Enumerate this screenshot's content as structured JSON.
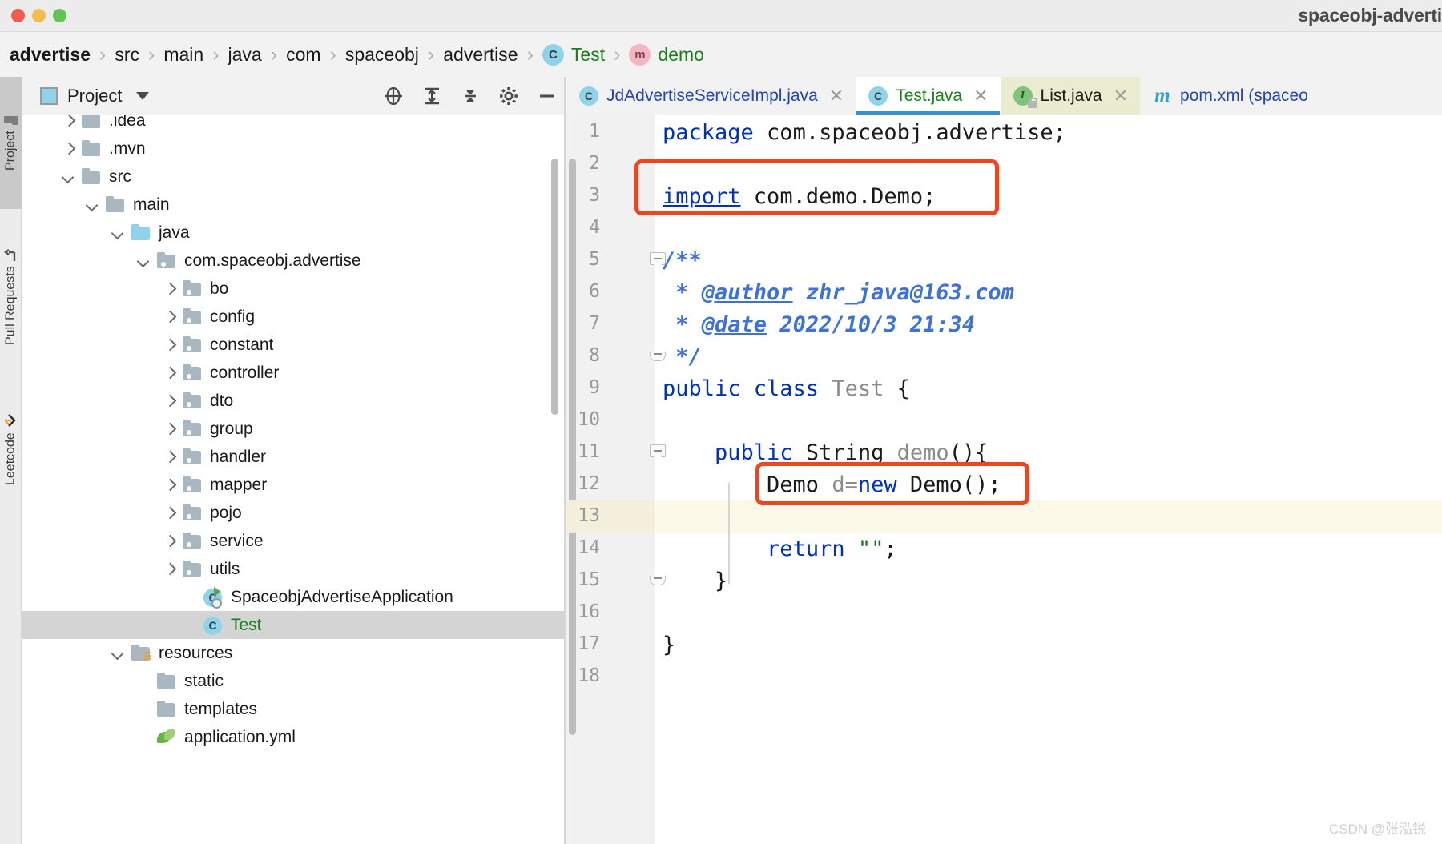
{
  "window": {
    "title": "spaceobj-adverti",
    "traffic_lights": [
      "close-red",
      "minimize-yellow",
      "zoom-green"
    ]
  },
  "breadcrumb": {
    "items": [
      {
        "label": "advertise",
        "style": "bold",
        "icon": null
      },
      {
        "label": "src",
        "style": "normal",
        "icon": null
      },
      {
        "label": "main",
        "style": "normal",
        "icon": null
      },
      {
        "label": "java",
        "style": "normal",
        "icon": null
      },
      {
        "label": "com",
        "style": "normal",
        "icon": null
      },
      {
        "label": "spaceobj",
        "style": "normal",
        "icon": null
      },
      {
        "label": "advertise",
        "style": "normal",
        "icon": null
      },
      {
        "label": "Test",
        "style": "green",
        "icon": "class-c-icon",
        "icon_char": "C"
      },
      {
        "label": "demo",
        "style": "green",
        "icon": "method-m-icon",
        "icon_char": "m"
      }
    ],
    "separator": "›"
  },
  "toolstrip": {
    "tabs": [
      {
        "label": "Project",
        "active": true
      },
      {
        "label": "Pull Requests",
        "active": false
      },
      {
        "label": "Leetcode",
        "active": false
      }
    ]
  },
  "project_panel": {
    "title": "Project",
    "actions": [
      {
        "name": "select-opened-file-icon"
      },
      {
        "name": "expand-all-icon"
      },
      {
        "name": "collapse-all-icon"
      },
      {
        "name": "settings-gear-icon"
      },
      {
        "name": "hide-panel-icon"
      }
    ]
  },
  "tree": {
    "items": [
      {
        "label": ".idea",
        "indent": 1,
        "arrow": "closed",
        "icon": "folder",
        "selected": false,
        "clipped": true
      },
      {
        "label": ".mvn",
        "indent": 1,
        "arrow": "closed",
        "icon": "folder",
        "selected": false
      },
      {
        "label": "src",
        "indent": 1,
        "arrow": "open",
        "icon": "folder",
        "selected": false
      },
      {
        "label": "main",
        "indent": 2,
        "arrow": "open",
        "icon": "folder",
        "selected": false
      },
      {
        "label": "java",
        "indent": 3,
        "arrow": "open",
        "icon": "folder-blue",
        "selected": false
      },
      {
        "label": "com.spaceobj.advertise",
        "indent": 4,
        "arrow": "open",
        "icon": "package",
        "selected": false
      },
      {
        "label": "bo",
        "indent": 5,
        "arrow": "closed",
        "icon": "package",
        "selected": false
      },
      {
        "label": "config",
        "indent": 5,
        "arrow": "closed",
        "icon": "package",
        "selected": false
      },
      {
        "label": "constant",
        "indent": 5,
        "arrow": "closed",
        "icon": "package",
        "selected": false
      },
      {
        "label": "controller",
        "indent": 5,
        "arrow": "closed",
        "icon": "package",
        "selected": false
      },
      {
        "label": "dto",
        "indent": 5,
        "arrow": "closed",
        "icon": "package",
        "selected": false
      },
      {
        "label": "group",
        "indent": 5,
        "arrow": "closed",
        "icon": "package",
        "selected": false
      },
      {
        "label": "handler",
        "indent": 5,
        "arrow": "closed",
        "icon": "package",
        "selected": false
      },
      {
        "label": "mapper",
        "indent": 5,
        "arrow": "closed",
        "icon": "package",
        "selected": false
      },
      {
        "label": "pojo",
        "indent": 5,
        "arrow": "closed",
        "icon": "package",
        "selected": false
      },
      {
        "label": "service",
        "indent": 5,
        "arrow": "closed",
        "icon": "package",
        "selected": false
      },
      {
        "label": "utils",
        "indent": 5,
        "arrow": "closed",
        "icon": "package",
        "selected": false
      },
      {
        "label": "SpaceobjAdvertiseApplication",
        "indent": 6,
        "arrow": "none",
        "icon": "spring-class",
        "selected": false
      },
      {
        "label": "Test",
        "indent": 6,
        "arrow": "none",
        "icon": "class",
        "selected": true
      },
      {
        "label": "resources",
        "indent": 3,
        "arrow": "open",
        "icon": "folder-res",
        "selected": false
      },
      {
        "label": "static",
        "indent": 4,
        "arrow": "none",
        "icon": "folder",
        "selected": false
      },
      {
        "label": "templates",
        "indent": 4,
        "arrow": "none",
        "icon": "folder",
        "selected": false
      },
      {
        "label": "application.yml",
        "indent": 4,
        "arrow": "none",
        "icon": "yml",
        "selected": false
      }
    ]
  },
  "tabs": {
    "items": [
      {
        "label": "JdAdvertiseServiceImpl.java",
        "icon": "class-c-icon",
        "icon_char": "C",
        "state": "inactive",
        "close": "✕"
      },
      {
        "label": "Test.java",
        "icon": "class-c-icon",
        "icon_char": "C",
        "state": "active",
        "close": "✕"
      },
      {
        "label": "List.java",
        "icon": "interface-i-icon",
        "icon_char": "I",
        "state": "olive",
        "close": "✕",
        "locked": true
      },
      {
        "label": "pom.xml (spaceo",
        "icon": "maven-m-icon",
        "icon_char": "m",
        "state": "inactive",
        "close": ""
      }
    ]
  },
  "editor": {
    "caret_line": 13,
    "line_numbers": [
      1,
      2,
      3,
      4,
      5,
      6,
      7,
      8,
      9,
      10,
      11,
      12,
      13,
      14,
      15,
      16,
      17,
      18
    ],
    "lines": [
      {
        "n": 1,
        "tokens": [
          {
            "t": "package",
            "c": "kw"
          },
          {
            "t": " com.spaceobj.advertise;",
            "c": "ident"
          }
        ]
      },
      {
        "n": 2,
        "tokens": []
      },
      {
        "n": 3,
        "tokens": [
          {
            "t": "import",
            "c": "kwu"
          },
          {
            "t": " com.demo.Demo;",
            "c": "ident"
          }
        ]
      },
      {
        "n": 4,
        "tokens": []
      },
      {
        "n": 5,
        "tokens": [
          {
            "t": "/**",
            "c": "doc"
          }
        ]
      },
      {
        "n": 6,
        "tokens": [
          {
            "t": " * ",
            "c": "doc"
          },
          {
            "t": "@author",
            "c": "doctag"
          },
          {
            "t": " zhr_java@163.com",
            "c": "doc"
          }
        ]
      },
      {
        "n": 7,
        "tokens": [
          {
            "t": " * ",
            "c": "doc"
          },
          {
            "t": "@date",
            "c": "doctag"
          },
          {
            "t": " 2022/10/3 21:34",
            "c": "doc"
          }
        ]
      },
      {
        "n": 8,
        "tokens": [
          {
            "t": " */",
            "c": "doc"
          }
        ]
      },
      {
        "n": 9,
        "tokens": [
          {
            "t": "public class ",
            "c": "kw"
          },
          {
            "t": "Test ",
            "c": "grey"
          },
          {
            "t": "{",
            "c": "ident"
          }
        ]
      },
      {
        "n": 10,
        "tokens": []
      },
      {
        "n": 11,
        "tokens": [
          {
            "t": "    ",
            "c": "ident"
          },
          {
            "t": "public ",
            "c": "kw"
          },
          {
            "t": "String ",
            "c": "ident"
          },
          {
            "t": "demo",
            "c": "grey"
          },
          {
            "t": "(){",
            "c": "ident"
          }
        ]
      },
      {
        "n": 12,
        "tokens": [
          {
            "t": "        Demo ",
            "c": "ident"
          },
          {
            "t": "d=",
            "c": "grey"
          },
          {
            "t": "new",
            "c": "kw"
          },
          {
            "t": " Demo();",
            "c": "ident"
          }
        ]
      },
      {
        "n": 13,
        "tokens": []
      },
      {
        "n": 14,
        "tokens": [
          {
            "t": "        ",
            "c": "ident"
          },
          {
            "t": "return",
            "c": "kw"
          },
          {
            "t": " ",
            "c": "ident"
          },
          {
            "t": "\"\"",
            "c": "str"
          },
          {
            "t": ";",
            "c": "ident"
          }
        ]
      },
      {
        "n": 15,
        "tokens": [
          {
            "t": "    }",
            "c": "ident"
          }
        ]
      },
      {
        "n": 16,
        "tokens": []
      },
      {
        "n": 17,
        "tokens": [
          {
            "t": "}",
            "c": "ident"
          }
        ]
      },
      {
        "n": 18,
        "tokens": []
      }
    ],
    "annotations": [
      {
        "name": "import-highlight-box",
        "line": 3,
        "color": "#ef4322"
      },
      {
        "name": "demo-instance-highlight-box",
        "line": 12,
        "color": "#ef4322"
      }
    ]
  },
  "watermark": {
    "text": "CSDN @张泓锐"
  },
  "colors": {
    "accent": "#3e8fd0",
    "annotation": "#ef4322",
    "keyword": "#0033b3",
    "string": "#067d17",
    "javadoc": "#3e73d4",
    "selection": "#d4d4d4",
    "caret_row": "#fdf9e8"
  }
}
